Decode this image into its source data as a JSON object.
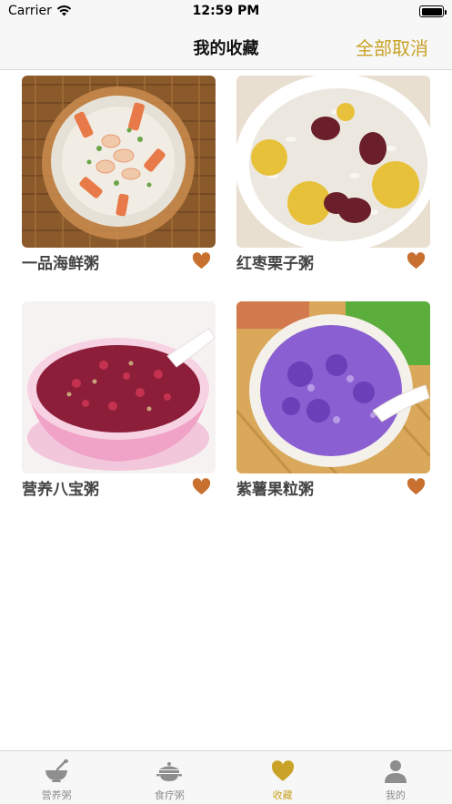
{
  "status_bar": {
    "carrier": "Carrier",
    "time": "12:59 PM",
    "battery_level": 1.0
  },
  "nav": {
    "title": "我的收藏",
    "action_label": "全部取消"
  },
  "favorites": [
    {
      "name": "一品海鲜粥",
      "favorited": true
    },
    {
      "name": "红枣栗子粥",
      "favorited": true
    },
    {
      "name": "营养八宝粥",
      "favorited": true
    },
    {
      "name": "紫薯果粒粥",
      "favorited": true
    }
  ],
  "tabs": [
    {
      "label": "营养粥",
      "icon": "bowl-spoon-icon",
      "active": false
    },
    {
      "label": "食疗粥",
      "icon": "pot-icon",
      "active": false
    },
    {
      "label": "收藏",
      "icon": "heart-icon",
      "active": true
    },
    {
      "label": "我的",
      "icon": "person-icon",
      "active": false
    }
  ],
  "colors": {
    "accent": "#c9a227",
    "heart": "#c8702f",
    "tab_inactive": "#8e8e8e",
    "label": "#444444"
  }
}
